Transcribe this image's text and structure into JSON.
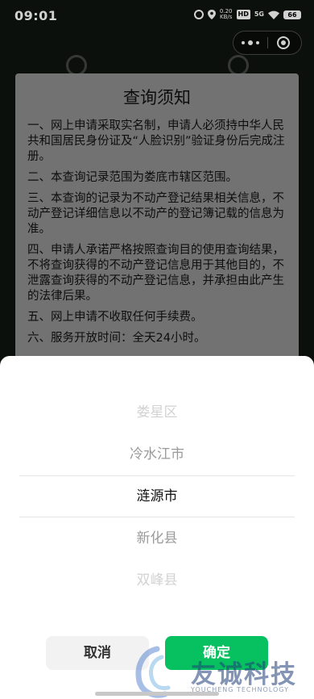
{
  "status_bar": {
    "time": "09:01",
    "network_speed": "0.20\nKB/s",
    "hd": "HD",
    "signal": "5G",
    "battery": "66"
  },
  "notice": {
    "title": "查询须知",
    "items": [
      "一、网上申请采取实名制，申请人必须持中华人民共和国居民身份证及“人脸识别”验证身份后完成注册。",
      "二、本查询记录范围为娄底市辖区范围。",
      "三、本查询的记录为不动产登记结果相关信息，不动产登记详细信息以不动产的登记簿记载的信息为准。",
      "四、申请人承诺严格按照查询目的使用查询结果，不将查询获得的不动产登记信息用于其他目的，不泄露查询获得的不动产登记信息，并承担由此产生的法律后果。",
      "五、网上申请不收取任何手续费。",
      "六、服务开放时间：全天24小时。"
    ]
  },
  "picker": {
    "options": [
      "娄星区",
      "冷水江市",
      "涟源市",
      "新化县",
      "双峰县"
    ],
    "selected": "涟源市"
  },
  "buttons": {
    "cancel": "取消",
    "confirm": "确定"
  },
  "watermark": {
    "name": "友诚科技",
    "sub": "YOUCHENG TECHNOLOGY"
  },
  "colors": {
    "accent": "#07c160",
    "notice_bg": "#8c8c8c"
  }
}
